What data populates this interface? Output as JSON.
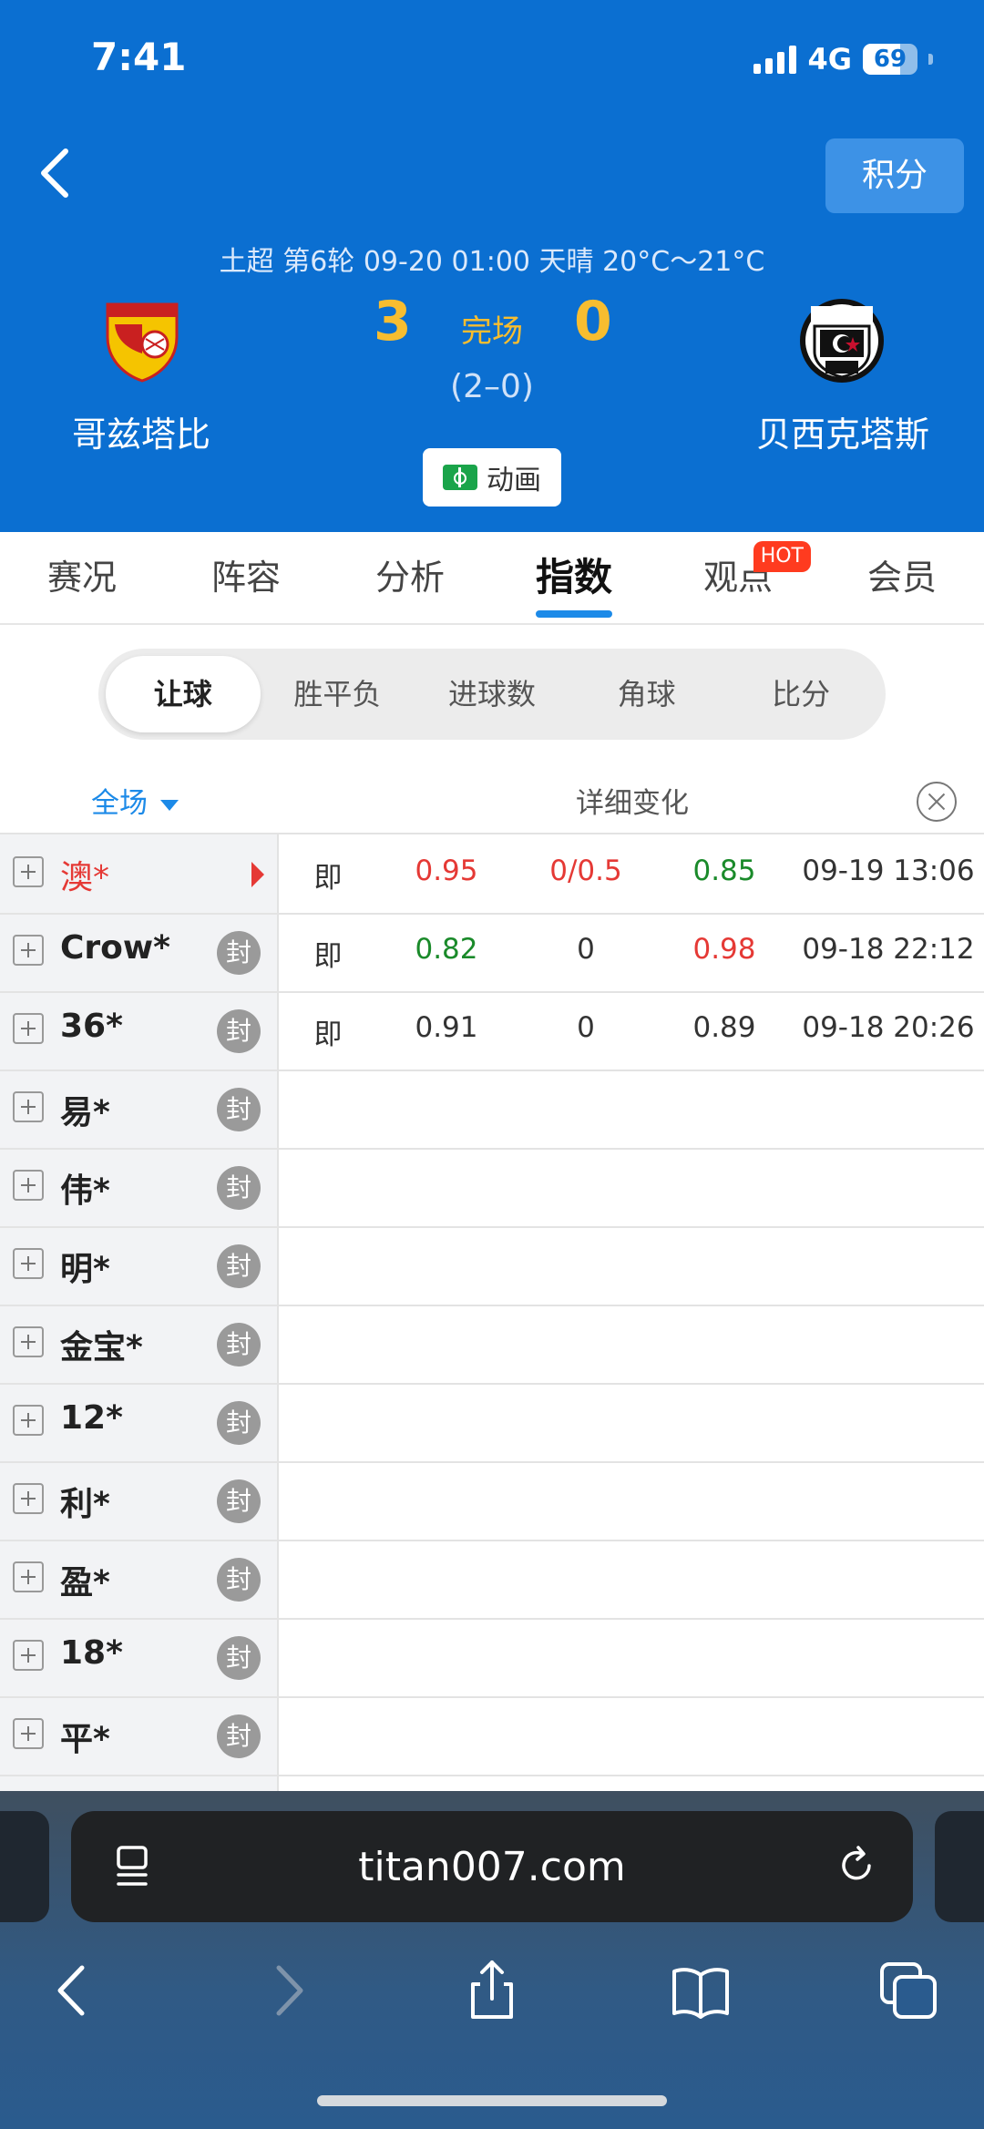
{
  "status_bar": {
    "time": "7:41",
    "network": "4G",
    "battery": "69",
    "battery_fraction": 0.69
  },
  "header": {
    "score_button": "积分",
    "match_info": "土超 第6轮 09-20 01:00 天晴 20°C～21°C",
    "home_team": "哥兹塔比",
    "away_team": "贝西克塔斯",
    "home_score": "3",
    "away_score": "0",
    "status": "完场",
    "half_time": "(2–0)",
    "animation_button": "动画"
  },
  "tabs": [
    {
      "label": "赛况"
    },
    {
      "label": "阵容"
    },
    {
      "label": "分析"
    },
    {
      "label": "指数",
      "active": true
    },
    {
      "label": "观点",
      "badge": "HOT"
    },
    {
      "label": "会员"
    }
  ],
  "sub_tabs": [
    {
      "label": "让球",
      "active": true
    },
    {
      "label": "胜平负"
    },
    {
      "label": "进球数"
    },
    {
      "label": "角球"
    },
    {
      "label": "比分"
    }
  ],
  "filter": {
    "scope": "全场",
    "detail": "详细变化"
  },
  "companies": [
    {
      "name": "澳*",
      "selected": true,
      "type": "即",
      "home": "0.95",
      "handicap": "0/0.5",
      "away": "0.85",
      "time": "09-19 13:06",
      "home_color": "red",
      "handicap_color": "red",
      "away_color": "green"
    },
    {
      "name": "Crow*",
      "seal": "封",
      "type": "即",
      "home": "0.82",
      "handicap": "0",
      "away": "0.98",
      "time": "09-18 22:12",
      "home_color": "green",
      "handicap_color": "plain",
      "away_color": "red"
    },
    {
      "name": "36*",
      "seal": "封",
      "type": "即",
      "home": "0.91",
      "handicap": "0",
      "away": "0.89",
      "time": "09-18 20:26",
      "home_color": "plain",
      "handicap_color": "plain",
      "away_color": "plain"
    },
    {
      "name": "易*",
      "seal": "封"
    },
    {
      "name": "伟*",
      "seal": "封"
    },
    {
      "name": "明*",
      "seal": "封"
    },
    {
      "name": "金宝*",
      "seal": "封"
    },
    {
      "name": "12*",
      "seal": "封"
    },
    {
      "name": "利*",
      "seal": "封"
    },
    {
      "name": "盈*",
      "seal": "封"
    },
    {
      "name": "18*",
      "seal": "封"
    },
    {
      "name": "平*",
      "seal": "封"
    }
  ],
  "browser": {
    "url": "titan007.com"
  },
  "colors": {
    "header_blue": "#0b6fd1",
    "score_gold": "#f7bd30",
    "accent_blue": "#1c8ae8",
    "red": "#e53935",
    "green": "#1a8a2a"
  }
}
